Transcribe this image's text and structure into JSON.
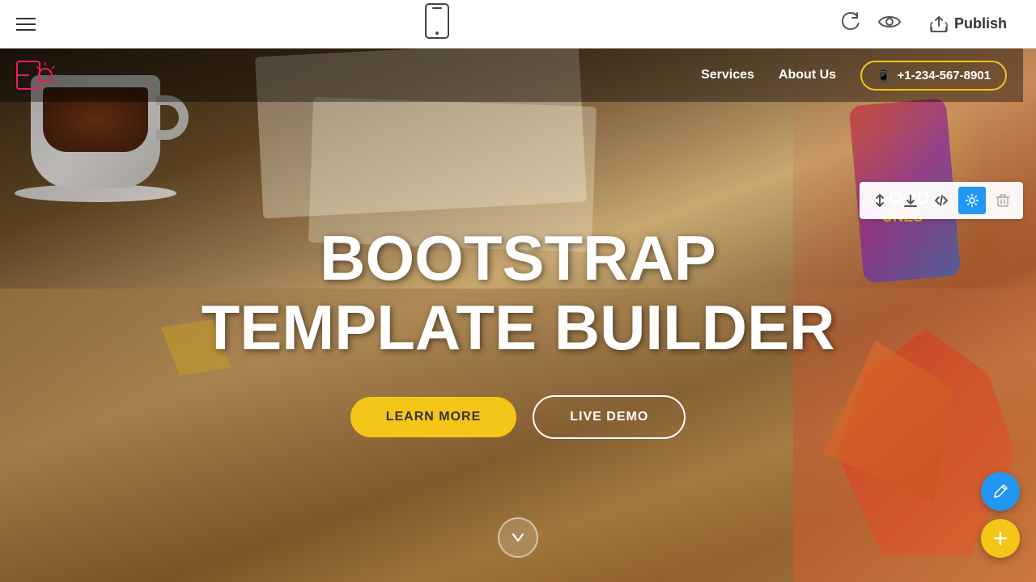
{
  "toolbar": {
    "publish_label": "Publish",
    "hamburger_label": "Menu",
    "mobile_preview_label": "Mobile Preview",
    "undo_label": "Undo",
    "preview_label": "Preview"
  },
  "nav": {
    "services_label": "Services",
    "about_us_label": "About Us",
    "phone_number": "+1-234-567-8901"
  },
  "hero": {
    "title_line1": "BOOTSTRAP",
    "title_line2": "TEMPLATE BUILDER",
    "learn_more_label": "LEARN MORE",
    "live_demo_label": "LIVE DEMO"
  },
  "section_toolbar": {
    "move_label": "↕",
    "download_label": "⬇",
    "code_label": "</>",
    "settings_label": "⚙",
    "delete_label": "🗑"
  },
  "fab": {
    "edit_label": "✏",
    "add_label": "+"
  },
  "colors": {
    "accent_yellow": "#f5c518",
    "accent_teal": "#00bcd4",
    "fab_blue": "#2196f3",
    "settings_blue": "#2196f3"
  }
}
